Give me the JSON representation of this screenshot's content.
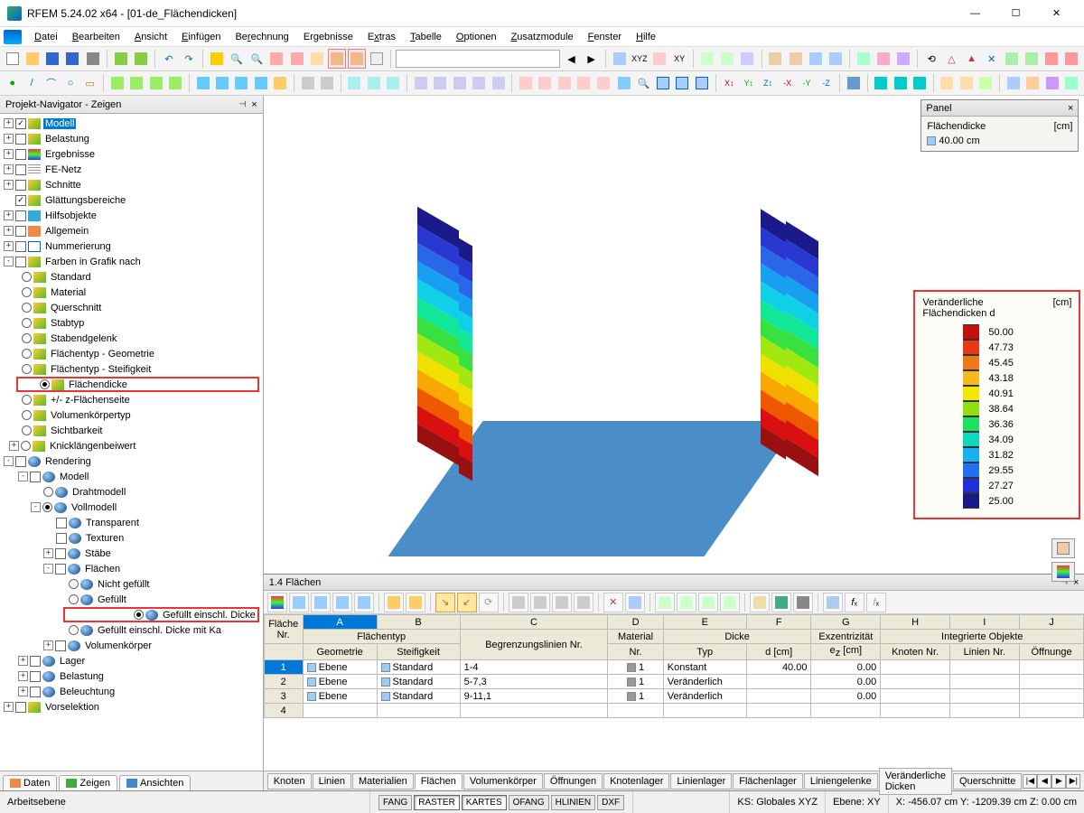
{
  "window": {
    "title": "RFEM 5.24.02 x64 - [01-de_Flächendicken]"
  },
  "menu": [
    "Datei",
    "Bearbeiten",
    "Ansicht",
    "Einfügen",
    "Berechnung",
    "Ergebnisse",
    "Extras",
    "Tabelle",
    "Optionen",
    "Zusatzmodule",
    "Fenster",
    "Hilfe"
  ],
  "navigator": {
    "title": "Projekt-Navigator - Zeigen",
    "tabs": {
      "data": "Daten",
      "show": "Zeigen",
      "views": "Ansichten"
    },
    "items": {
      "modell": "Modell",
      "belastung": "Belastung",
      "ergebnisse": "Ergebnisse",
      "fenetz": "FE-Netz",
      "schnitte": "Schnitte",
      "glaettung": "Glättungsbereiche",
      "hilfsobjekte": "Hilfsobjekte",
      "allgemein": "Allgemein",
      "nummerierung": "Nummerierung",
      "farben": "Farben in Grafik nach",
      "standard": "Standard",
      "material": "Material",
      "querschnitt": "Querschnitt",
      "stabtyp": "Stabtyp",
      "stabendgelenk": "Stabendgelenk",
      "flaechentyp_geo": "Flächentyp - Geometrie",
      "flaechentyp_stf": "Flächentyp - Steifigkeit",
      "flaechendicke": "Flächendicke",
      "pmz": "+/- z-Flächenseite",
      "volumenkoerpertyp": "Volumenkörpertyp",
      "sichtbarkeit": "Sichtbarkeit",
      "knicklaenge": "Knicklängenbeiwert",
      "rendering": "Rendering",
      "r_modell": "Modell",
      "drahtmodell": "Drahtmodell",
      "vollmodell": "Vollmodell",
      "transparent": "Transparent",
      "texturen": "Texturen",
      "staebe": "Stäbe",
      "flaechen": "Flächen",
      "nicht_gefuellt": "Nicht gefüllt",
      "gefuellt": "Gefüllt",
      "gefuellt_dicke": "Gefüllt einschl. Dicke",
      "gefuellt_dicke_ka": "Gefüllt einschl. Dicke mit Ka",
      "volumenkoerper": "Volumenkörper",
      "lager": "Lager",
      "l_belastung": "Belastung",
      "beleuchtung": "Beleuchtung",
      "vorselektion": "Vorselektion"
    }
  },
  "panel": {
    "title": "Panel",
    "label": "Flächendicke",
    "unit": "[cm]",
    "value": "40.00 cm"
  },
  "legend": {
    "title1": "Veränderliche",
    "title2": "Flächendicken d",
    "unit": "[cm]",
    "items": [
      {
        "c": "#c01010",
        "v": "50.00"
      },
      {
        "c": "#e83818",
        "v": "47.73"
      },
      {
        "c": "#f07818",
        "v": "45.45"
      },
      {
        "c": "#f8b820",
        "v": "43.18"
      },
      {
        "c": "#f0e800",
        "v": "40.91"
      },
      {
        "c": "#90e010",
        "v": "38.64"
      },
      {
        "c": "#20e060",
        "v": "36.36"
      },
      {
        "c": "#10d8c0",
        "v": "34.09"
      },
      {
        "c": "#18b0f0",
        "v": "31.82"
      },
      {
        "c": "#2070f0",
        "v": "29.55"
      },
      {
        "c": "#2030d8",
        "v": "27.27"
      },
      {
        "c": "#181888",
        "v": "25.00"
      }
    ]
  },
  "table": {
    "title": "1.4 Flächen",
    "letters": [
      "A",
      "B",
      "C",
      "D",
      "E",
      "F",
      "G",
      "H",
      "I",
      "J"
    ],
    "groups": {
      "flaeche_nr": "Fläche\nNr.",
      "flaechentyp": "Flächentyp",
      "geometrie": "Geometrie",
      "steifigkeit": "Steifigkeit",
      "begrenzung": "Begrenzungslinien Nr.",
      "material_nr": "Material\nNr.",
      "dicke": "Dicke",
      "typ": "Typ",
      "d_cm": "d [cm]",
      "exz_head": "Exzentrizität",
      "exz": "e₂ [cm]",
      "integrierte": "Integrierte Objekte",
      "knoten": "Knoten Nr.",
      "linien": "Linien Nr.",
      "oeffnungen": "Öffnunge"
    },
    "rows": [
      {
        "n": "1",
        "geo": "Ebene",
        "stf": "Standard",
        "beg": "1-4",
        "mat": "1",
        "typ": "Konstant",
        "d": "40.00",
        "ez": "0.00"
      },
      {
        "n": "2",
        "geo": "Ebene",
        "stf": "Standard",
        "beg": "5-7,3",
        "mat": "1",
        "typ": "Veränderlich",
        "d": "",
        "ez": "0.00"
      },
      {
        "n": "3",
        "geo": "Ebene",
        "stf": "Standard",
        "beg": "9-11,1",
        "mat": "1",
        "typ": "Veränderlich",
        "d": "",
        "ez": "0.00"
      },
      {
        "n": "4",
        "geo": "",
        "stf": "",
        "beg": "",
        "mat": "",
        "typ": "",
        "d": "",
        "ez": ""
      }
    ],
    "tabs": [
      "Knoten",
      "Linien",
      "Materialien",
      "Flächen",
      "Volumenkörper",
      "Öffnungen",
      "Knotenlager",
      "Linienlager",
      "Flächenlager",
      "Liniengelenke",
      "Veränderliche Dicken",
      "Querschnitte"
    ]
  },
  "status": {
    "left": "Arbeitsebene",
    "toggles": [
      "FANG",
      "RASTER",
      "KARTES",
      "OFANG",
      "HLINIEN",
      "DXF"
    ],
    "pressed": [
      false,
      true,
      true,
      false,
      false,
      false
    ],
    "cs": "KS: Globales XYZ",
    "plane": "Ebene: XY",
    "coords": "X:  -456.07 cm Y:  -1209.39 cm Z:  0.00 cm"
  }
}
